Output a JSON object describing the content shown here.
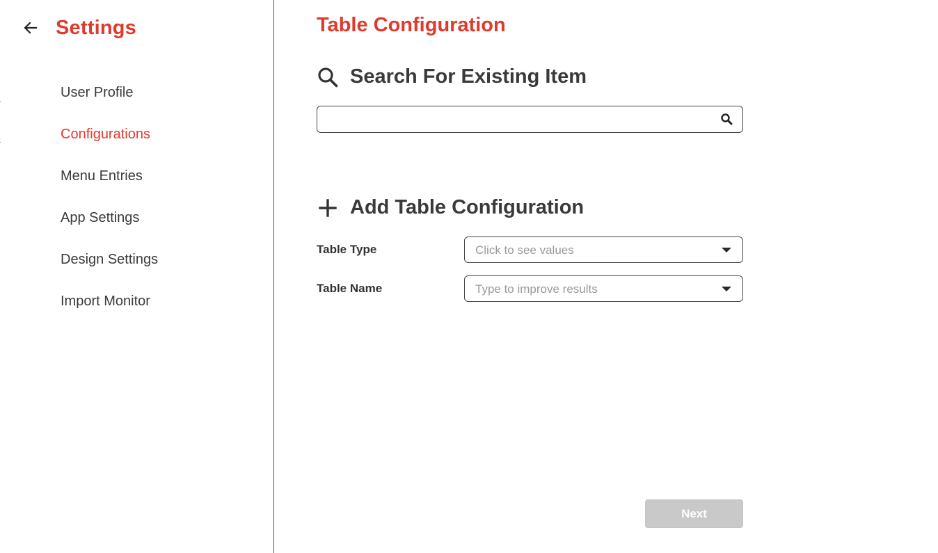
{
  "sidebar": {
    "back_icon": "arrow-left-icon",
    "title": "Settings",
    "items": [
      {
        "label": "User Profile",
        "active": false
      },
      {
        "label": "Configurations",
        "active": true
      },
      {
        "label": "Menu Entries",
        "active": false
      },
      {
        "label": "App Settings",
        "active": false
      },
      {
        "label": "Design Settings",
        "active": false
      },
      {
        "label": "Import Monitor",
        "active": false
      }
    ]
  },
  "main": {
    "title": "Table Configuration",
    "search_section": {
      "icon": "search-icon",
      "heading": "Search For Existing Item",
      "input_value": "",
      "input_placeholder": "",
      "button_icon": "search-icon"
    },
    "add_section": {
      "icon": "plus-icon",
      "heading": "Add Table Configuration",
      "fields": [
        {
          "label": "Table Type",
          "placeholder": "Click to see values",
          "value": "",
          "icon": "caret-down-icon"
        },
        {
          "label": "Table Name",
          "placeholder": "Type to improve results",
          "value": "",
          "icon": "caret-down-icon"
        }
      ]
    },
    "next_button": {
      "label": "Next",
      "disabled": true
    }
  },
  "colors": {
    "accent": "#e03a2c",
    "text": "#333333",
    "placeholder": "#9a9a9a",
    "disabled_button": "#c9c9c9"
  }
}
